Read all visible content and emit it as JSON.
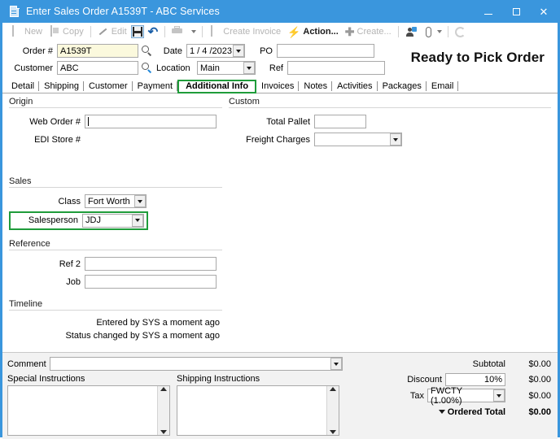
{
  "window": {
    "title": "Enter Sales Order A1539T - ABC Services",
    "doc_icon": "document-icon",
    "minimize": "–",
    "maximize": "□",
    "close": "×"
  },
  "toolbar": {
    "items": [
      {
        "label": "New",
        "icon": "new-document-icon",
        "enabled": false
      },
      {
        "label": "Copy",
        "icon": "copy-icon",
        "enabled": false
      },
      {
        "label": "Edit",
        "icon": "pencil-icon",
        "enabled": false
      },
      {
        "label": "",
        "icon": "save-icon",
        "enabled": true
      },
      {
        "label": "",
        "icon": "undo-icon",
        "enabled": true
      },
      {
        "label": "",
        "icon": "print-icon",
        "enabled": false
      },
      {
        "label": "Create Invoice",
        "icon": "create-invoice-icon",
        "enabled": false
      },
      {
        "label": "Action...",
        "icon": "lightning-bolt-icon",
        "enabled": true
      },
      {
        "label": "Create...",
        "icon": "plus-icon",
        "enabled": false
      },
      {
        "label": "",
        "icon": "user-add-icon",
        "enabled": true
      },
      {
        "label": "",
        "icon": "paperclip-icon",
        "enabled": true
      },
      {
        "label": "",
        "icon": "refresh-icon",
        "enabled": false
      }
    ]
  },
  "header": {
    "order_label": "Order #",
    "order_value": "A1539T",
    "order_search_icon": "search-icon",
    "customer_label": "Customer",
    "customer_value": "ABC",
    "customer_search_icon": "search-icon",
    "date_label": "Date",
    "date_value": "1 / 4 /2023",
    "location_label": "Location",
    "location_value": "Main",
    "po_label": "PO",
    "po_value": "",
    "ref_label": "Ref",
    "ref_value": "",
    "status_banner": "Ready to Pick Order"
  },
  "tabs": [
    {
      "label": "Detail",
      "active": false
    },
    {
      "label": "Shipping",
      "active": false
    },
    {
      "label": "Customer",
      "active": false
    },
    {
      "label": "Payment",
      "active": false
    },
    {
      "label": "Additional Info",
      "active": true
    },
    {
      "label": "Invoices",
      "active": false
    },
    {
      "label": "Notes",
      "active": false
    },
    {
      "label": "Activities",
      "active": false
    },
    {
      "label": "Packages",
      "active": false
    },
    {
      "label": "Email",
      "active": false
    }
  ],
  "origin": {
    "title": "Origin",
    "web_order_label": "Web Order #",
    "web_order_value": "",
    "edi_store_label": "EDI Store #",
    "edi_store_value": ""
  },
  "custom": {
    "title": "Custom",
    "total_pallet_label": "Total Pallet",
    "total_pallet_value": "",
    "freight_charges_label": "Freight Charges",
    "freight_charges_value": ""
  },
  "sales": {
    "title": "Sales",
    "class_label": "Class",
    "class_value": "Fort Worth",
    "salesperson_label": "Salesperson",
    "salesperson_value": "JDJ"
  },
  "reference": {
    "title": "Reference",
    "ref2_label": "Ref 2",
    "ref2_value": "",
    "job_label": "Job",
    "job_value": ""
  },
  "timeline": {
    "title": "Timeline",
    "entries": [
      "Entered by SYS  a moment ago",
      "Status changed by SYS  a moment ago"
    ]
  },
  "bottom": {
    "comment_label": "Comment",
    "comment_value": "",
    "special_instructions_label": "Special Instructions",
    "special_instructions_value": "",
    "shipping_instructions_label": "Shipping Instructions",
    "shipping_instructions_value": ""
  },
  "totals": {
    "subtotal_label": "Subtotal",
    "subtotal_value": "$0.00",
    "discount_label": "Discount",
    "discount_input": "10%",
    "discount_value": "$0.00",
    "tax_label": "Tax",
    "tax_select": "FWCTY (1.00%)",
    "tax_value": "$0.00",
    "ordered_total_label": "Ordered Total",
    "ordered_total_value": "$0.00"
  },
  "colors": {
    "titlebar": "#3a96dd",
    "highlight_green": "#1f9c3a",
    "field_yellow": "#fbf9dd",
    "accent_blue": "#1f86d8"
  }
}
